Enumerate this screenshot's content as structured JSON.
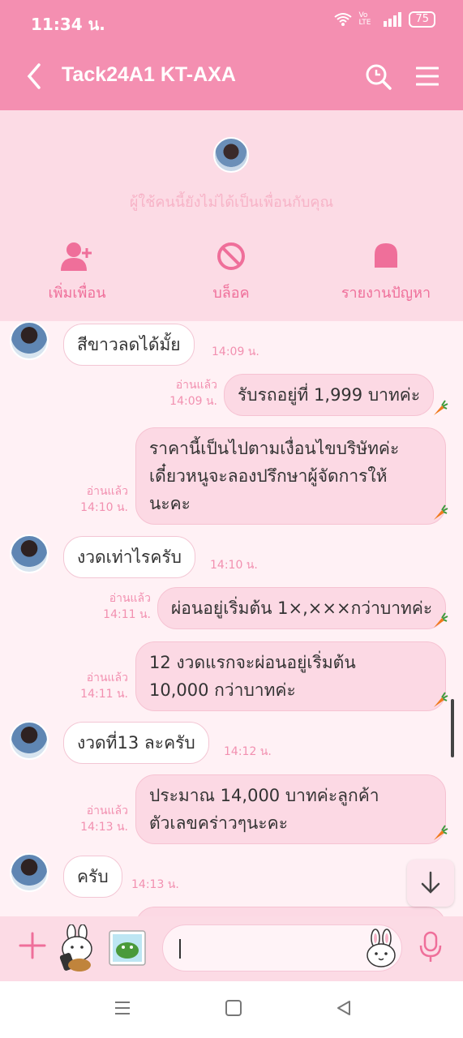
{
  "status": {
    "time": "11:34 น.",
    "battery": "75",
    "net": "Vo LTE"
  },
  "header": {
    "title": "Tack24A1 KT-AXA"
  },
  "panel": {
    "note": "ผู้ใช้คนนี้ยังไม่ได้เป็นเพื่อนกับคุณ",
    "add_friend": "เพิ่มเพื่อน",
    "block": "บล็อค",
    "report": "รายงานปัญหา"
  },
  "messages": [
    {
      "dir": "in",
      "text": "สีขาวลดได้มั้ย",
      "time": "14:09 น."
    },
    {
      "dir": "out",
      "read": "อ่านแล้ว",
      "time": "14:09 น.",
      "text": "รับรถอยู่ที่ 1,999 บาทค่ะ"
    },
    {
      "dir": "out",
      "read": "อ่านแล้ว",
      "time": "14:10 น.",
      "lines": [
        "ราคานี้เป็นไปตามเงื่อนไขบริษัทค่ะ",
        "เดี๋ยวหนูจะลองปรึกษาผู้จัดการให้",
        "นะคะ"
      ]
    },
    {
      "dir": "in",
      "text": "งวดเท่าไรครับ",
      "time": "14:10 น."
    },
    {
      "dir": "out",
      "read": "อ่านแล้ว",
      "time": "14:11 น.",
      "text": "ผ่อนอยู่เริ่มต้น 1×,×××กว่าบาทค่ะ"
    },
    {
      "dir": "out",
      "read": "อ่านแล้ว",
      "time": "14:11 น.",
      "lines": [
        "12 งวดแรกจะผ่อนอยู่เริ่มต้น",
        "10,000 กว่าบาทค่ะ"
      ]
    },
    {
      "dir": "in",
      "text": "งวดที่13 ละครับ",
      "time": "14:12 น."
    },
    {
      "dir": "out",
      "read": "อ่านแล้ว",
      "time": "14:13 น.",
      "lines": [
        "ประมาณ 14,000 บาทค่ะลูกค้า",
        "ตัวเลขคร่าวๆนะคะ"
      ]
    },
    {
      "dir": "in",
      "text": "ครับ",
      "time": "14:13 น."
    }
  ],
  "colors": {
    "accent": "#f48fb1",
    "panel": "#fcdbe5",
    "chat_bg": "#fff1f5",
    "out_bubble": "#fcd9e4"
  },
  "icons": [
    "back-icon",
    "search-icon",
    "menu-icon",
    "add-friend-icon",
    "block-icon",
    "report-icon",
    "carrot-icon",
    "scroll-down-icon",
    "plus-icon",
    "sticker-icon",
    "mic-icon"
  ]
}
